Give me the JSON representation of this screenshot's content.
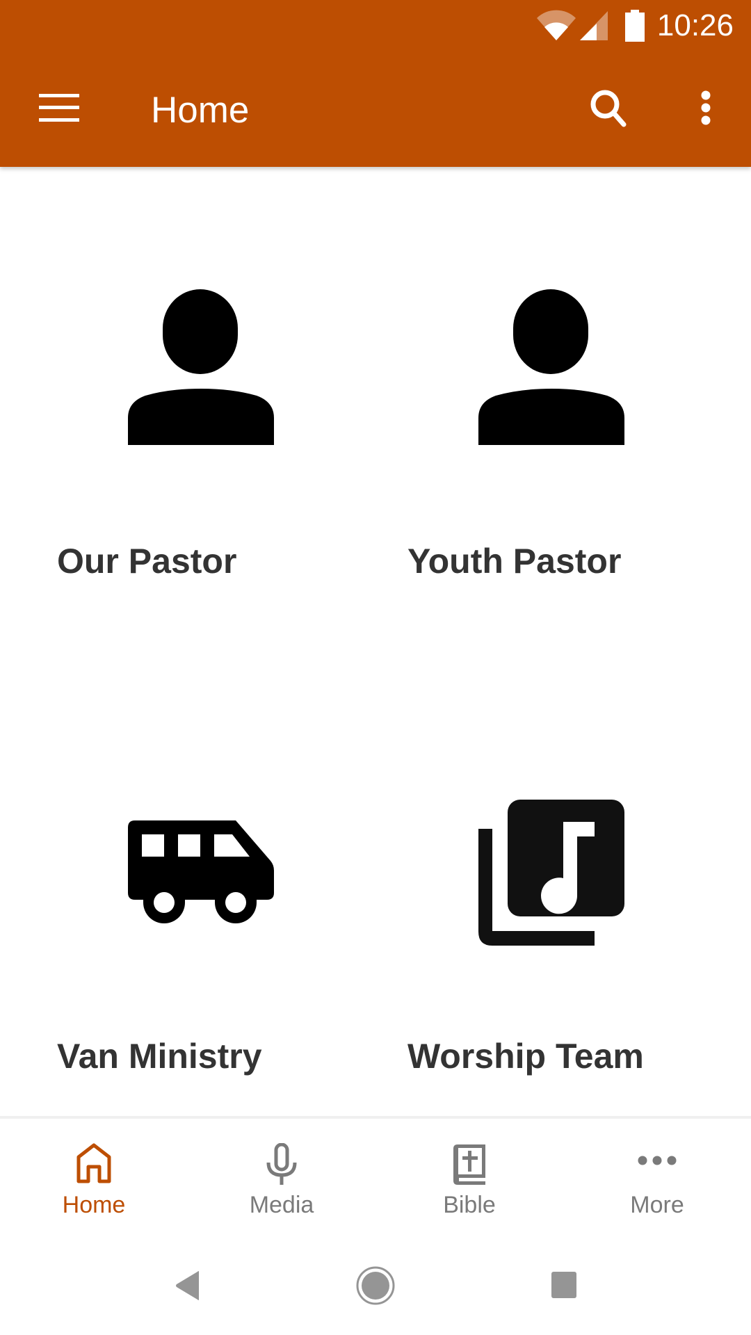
{
  "status_bar": {
    "time": "10:26",
    "icons": [
      "wifi-icon",
      "cell-signal-icon",
      "battery-icon"
    ]
  },
  "toolbar": {
    "title": "Home",
    "menu_icon": "hamburger-menu-icon",
    "search_icon": "search-icon",
    "more_icon": "more-vert-icon"
  },
  "tiles": [
    {
      "label": "Our Pastor",
      "icon": "person-icon"
    },
    {
      "label": "Youth Pastor",
      "icon": "person-icon"
    },
    {
      "label": "Van Ministry",
      "icon": "van-icon"
    },
    {
      "label": "Worship Team",
      "icon": "music-library-icon"
    }
  ],
  "bottom_nav": {
    "items": [
      {
        "label": "Home",
        "icon": "home-icon",
        "active": true
      },
      {
        "label": "Media",
        "icon": "microphone-icon",
        "active": false
      },
      {
        "label": "Bible",
        "icon": "bible-icon",
        "active": false
      },
      {
        "label": "More",
        "icon": "more-horiz-icon",
        "active": false
      }
    ]
  },
  "colors": {
    "primary": "#bd4e02",
    "label_text": "#333333",
    "inactive_nav": "#7a7a7a",
    "icon": "#000000"
  },
  "system_nav": [
    "back-icon",
    "home-circle-icon",
    "recents-icon"
  ]
}
